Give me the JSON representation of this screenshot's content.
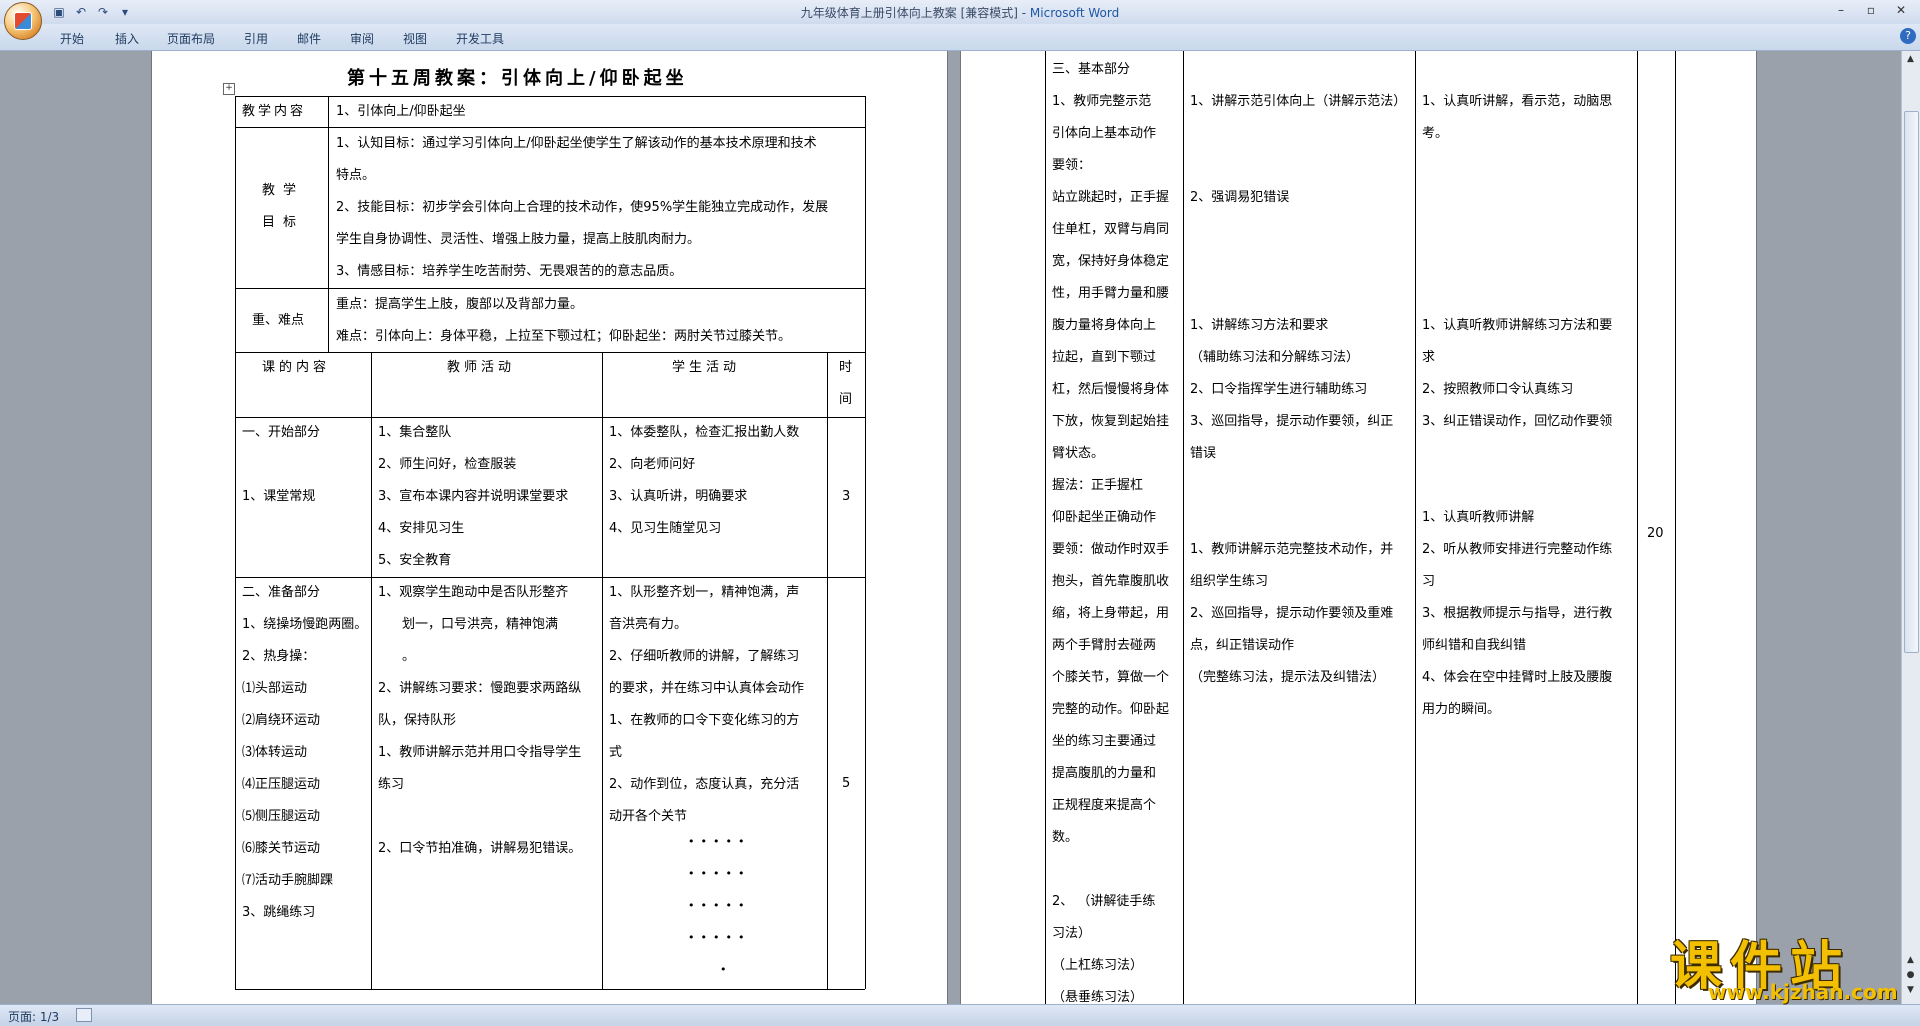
{
  "window": {
    "title_doc": "九年级体育上册引体向上教案 [兼容模式] - ",
    "title_app": "Microsoft Word",
    "minimize": "–",
    "maximize": "▫",
    "close": "✕"
  },
  "qat": {
    "save": "▣",
    "undo": "↶",
    "redo": "↷",
    "more": "▾"
  },
  "ribbon": {
    "tabs": [
      "开始",
      "插入",
      "页面布局",
      "引用",
      "邮件",
      "审阅",
      "视图",
      "开发工具"
    ]
  },
  "help": "?",
  "status": {
    "page": "页面: 1/3"
  },
  "watermark": {
    "main": "课件站",
    "url": "www.kjzhan.com"
  },
  "document": {
    "title": "第十五周教案：引体向上/仰卧起坐",
    "content_label": "教学内容",
    "content_value": "1、引体向上/仰卧起坐",
    "goals_label_1": "教学",
    "goals_label_2": "目标",
    "goals": [
      "1、认知目标：通过学习引体向上/仰卧起坐使学生了解该动作的基本技术原理和技术",
      "特点。",
      "2、技能目标：初步学会引体向上合理的技术动作，使95%学生能独立完成动作，发展",
      "学生自身协调性、灵活性、增强上肢力量，提高上肢肌肉耐力。",
      "3、情感目标：培养学生吃苦耐劳、无畏艰苦的的意志品质。"
    ],
    "key_label": "重、难点",
    "key_points": [
      "重点：提高学生上肢，腹部以及背部力量。",
      "难点：引体向上：身体平稳，上拉至下颚过杠；仰卧起坐：两肘关节过膝关节。"
    ],
    "col_headers": {
      "content": "课的内容",
      "teacher": "教师活动",
      "student": "学生活动",
      "time_1": "时",
      "time_2": "间"
    },
    "section1": {
      "content": [
        "一、开始部分",
        "",
        "1、课堂常规",
        ""
      ],
      "teacher": [
        "1、集合整队",
        "2、师生问好，检查服装",
        "3、宣布本课内容并说明课堂要求",
        "4、安排见习生",
        "5、安全教育"
      ],
      "student": [
        "1、体委整队，检查汇报出勤人数",
        "2、向老师问好",
        "3、认真听讲，明确要求",
        "4、见习生随堂见习"
      ],
      "time": "3"
    },
    "section2": {
      "content": [
        "二、准备部分",
        "1、绕操场慢跑两圈。",
        "2、热身操：",
        "⑴头部运动",
        "⑵肩绕环运动",
        "⑶体转运动",
        "⑷正压腿运动",
        "⑸侧压腿运动",
        "⑹膝关节运动",
        "⑺活动手腕脚踝",
        "3、跳绳练习"
      ],
      "teacher": [
        "1、观察学生跑动中是否队形整齐",
        "划一，口号洪亮，精神饱满",
        "。",
        "2、讲解练习要求：慢跑要求两路纵",
        "队，保持队形",
        "1、教师讲解示范并用口令指导学生",
        "练习",
        "",
        "2、口令节拍准确，讲解易犯错误。",
        "",
        ""
      ],
      "student": [
        "1、队形整齐划一，精神饱满，声",
        "音洪亮有力。",
        "2、仔细听教师的讲解，了解练习",
        "的要求，并在练习中认真体会动作",
        "1、在教师的口令下变化练习的方",
        "式",
        "2、动作到位，态度认真，充分活",
        "动开各个关节"
      ],
      "formation": [
        "•••••",
        "•••••",
        "•••••",
        "•••••",
        "•"
      ],
      "time": "5"
    },
    "basic": {
      "content": [
        "三、基本部分",
        "1、教师完整示范",
        "引体向上基本动作",
        "要领：",
        "站立跳起时，正手握",
        "住单杠，双臂与肩同",
        "宽，保持好身体稳定",
        "性，用手臂力量和腰",
        "腹力量将身体向上",
        "拉起，直到下颚过",
        "杠，然后慢慢将身体",
        "下放，恢复到起始挂",
        "臂状态。",
        "握法：正手握杠",
        "仰卧起坐正确动作",
        "要领：做动作时双手",
        "抱头，首先靠腹肌收",
        "缩，将上身带起，用",
        "两个手臂肘去碰两",
        "个膝关节，算做一个",
        "完整的动作。仰卧起",
        "坐的练习主要通过",
        "提高腹肌的力量和",
        "正规程度来提高个",
        "数。",
        "",
        "2、  （讲解徒手练",
        "习法）",
        "（上杠练习法）",
        "（悬垂练习法）"
      ],
      "teacher": [
        "",
        "1、讲解示范引体向上（讲解示范法）",
        "",
        "",
        "2、强调易犯错误",
        "",
        "",
        "",
        "1、讲解练习方法和要求",
        "（辅助练习法和分解练习法）",
        "2、口令指挥学生进行辅助练习",
        "3、巡回指导，提示动作要领，纠正",
        "错误",
        "",
        "",
        "1、教师讲解示范完整技术动作，并",
        "组织学生练习",
        "2、巡回指导，提示动作要领及重难",
        "点，纠正错误动作",
        "（完整练习法，提示法及纠错法）",
        "",
        "",
        "",
        "",
        "",
        "",
        ""
      ],
      "student": [
        "",
        "1、认真听讲解，看示范，动脑思",
        "考。",
        "",
        "",
        "",
        "",
        "",
        "1、认真听教师讲解练习方法和要",
        "求",
        "2、按照教师口令认真练习",
        "3、纠正错误动作，回忆动作要领",
        "",
        "",
        "1、认真听教师讲解",
        "2、听从教师安排进行完整动作练",
        "习",
        "3、根据教师提示与指导，进行教",
        "师纠错和自我纠错",
        "4、体会在空中挂臂时上肢及腰腹",
        "用力的瞬间。"
      ],
      "time": "20"
    }
  }
}
